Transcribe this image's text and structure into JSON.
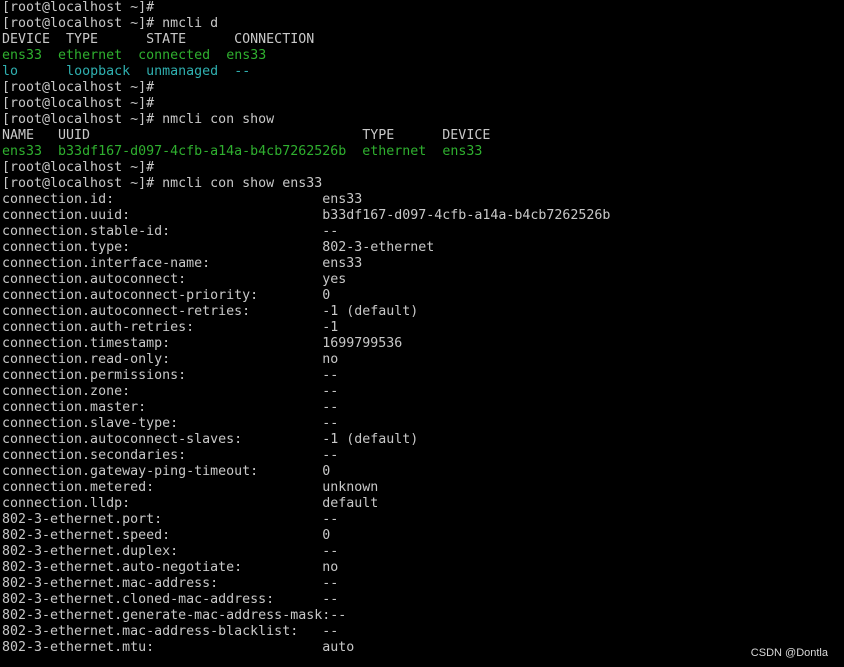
{
  "colors": {
    "fg": "#c8c8c8",
    "green": "#2fb02f",
    "cyan": "#2fb0b0",
    "bg": "#000000"
  },
  "terminal": {
    "lines": [
      [
        {
          "t": "[root@localhost ~]#"
        }
      ],
      [
        {
          "t": "[root@localhost ~]# nmcli d"
        }
      ],
      [
        {
          "t": "DEVICE  TYPE      STATE      CONNECTION"
        }
      ],
      [
        {
          "t": "ens33",
          "c": "green"
        },
        {
          "t": "  "
        },
        {
          "t": "ethernet",
          "c": "green"
        },
        {
          "t": "  "
        },
        {
          "t": "connected",
          "c": "green"
        },
        {
          "t": "  "
        },
        {
          "t": "ens33",
          "c": "green"
        }
      ],
      [
        {
          "t": "lo",
          "c": "cyan"
        },
        {
          "t": "      "
        },
        {
          "t": "loopback",
          "c": "cyan"
        },
        {
          "t": "  "
        },
        {
          "t": "unmanaged",
          "c": "cyan"
        },
        {
          "t": "  "
        },
        {
          "t": "--",
          "c": "cyan"
        }
      ],
      [
        {
          "t": "[root@localhost ~]#"
        }
      ],
      [
        {
          "t": "[root@localhost ~]#"
        }
      ],
      [
        {
          "t": "[root@localhost ~]# nmcli con show"
        }
      ],
      [
        {
          "t": "NAME   UUID                                  TYPE      DEVICE"
        }
      ],
      [
        {
          "t": "ens33",
          "c": "green"
        },
        {
          "t": "  "
        },
        {
          "t": "b33df167-d097-4cfb-a14a-b4cb7262526b",
          "c": "green"
        },
        {
          "t": "  "
        },
        {
          "t": "ethernet",
          "c": "green"
        },
        {
          "t": "  "
        },
        {
          "t": "ens33",
          "c": "green"
        }
      ],
      [
        {
          "t": "[root@localhost ~]#"
        }
      ],
      [
        {
          "t": "[root@localhost ~]# nmcli con show ens33"
        }
      ],
      [
        {
          "t": "connection.id:                          ens33"
        }
      ],
      [
        {
          "t": "connection.uuid:                        b33df167-d097-4cfb-a14a-b4cb7262526b"
        }
      ],
      [
        {
          "t": "connection.stable-id:                   --"
        }
      ],
      [
        {
          "t": "connection.type:                        802-3-ethernet"
        }
      ],
      [
        {
          "t": "connection.interface-name:              ens33"
        }
      ],
      [
        {
          "t": "connection.autoconnect:                 yes"
        }
      ],
      [
        {
          "t": "connection.autoconnect-priority:        0"
        }
      ],
      [
        {
          "t": "connection.autoconnect-retries:         -1 (default)"
        }
      ],
      [
        {
          "t": "connection.auth-retries:                -1"
        }
      ],
      [
        {
          "t": "connection.timestamp:                   1699799536"
        }
      ],
      [
        {
          "t": "connection.read-only:                   no"
        }
      ],
      [
        {
          "t": "connection.permissions:                 --"
        }
      ],
      [
        {
          "t": "connection.zone:                        --"
        }
      ],
      [
        {
          "t": "connection.master:                      --"
        }
      ],
      [
        {
          "t": "connection.slave-type:                  --"
        }
      ],
      [
        {
          "t": "connection.autoconnect-slaves:          -1 (default)"
        }
      ],
      [
        {
          "t": "connection.secondaries:                 --"
        }
      ],
      [
        {
          "t": "connection.gateway-ping-timeout:        0"
        }
      ],
      [
        {
          "t": "connection.metered:                     unknown"
        }
      ],
      [
        {
          "t": "connection.lldp:                        default"
        }
      ],
      [
        {
          "t": "802-3-ethernet.port:                    --"
        }
      ],
      [
        {
          "t": "802-3-ethernet.speed:                   0"
        }
      ],
      [
        {
          "t": "802-3-ethernet.duplex:                  --"
        }
      ],
      [
        {
          "t": "802-3-ethernet.auto-negotiate:          no"
        }
      ],
      [
        {
          "t": "802-3-ethernet.mac-address:             --"
        }
      ],
      [
        {
          "t": "802-3-ethernet.cloned-mac-address:      --"
        }
      ],
      [
        {
          "t": "802-3-ethernet.generate-mac-address-mask:--"
        }
      ],
      [
        {
          "t": "802-3-ethernet.mac-address-blacklist:   --"
        }
      ],
      [
        {
          "t": "802-3-ethernet.mtu:                     auto"
        }
      ]
    ]
  },
  "watermark": "CSDN @Dontla"
}
